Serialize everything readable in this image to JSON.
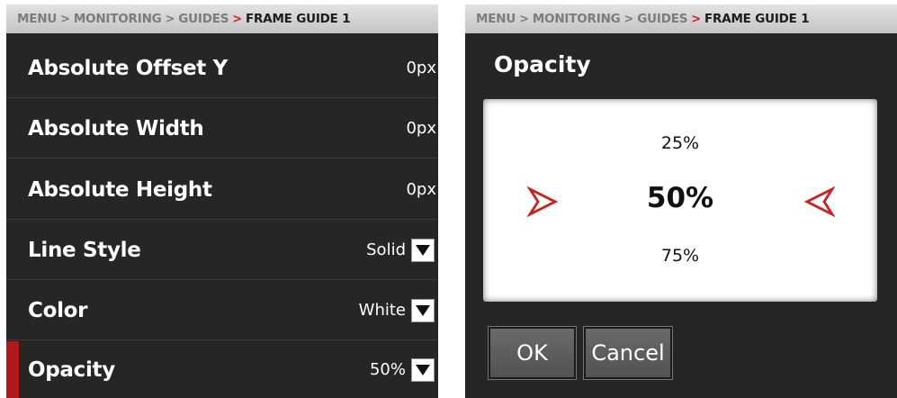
{
  "breadcrumb": {
    "items": [
      "MENU",
      "MONITORING",
      "GUIDES"
    ],
    "separator": ">",
    "current": "FRAME GUIDE 1"
  },
  "settings": {
    "rows": [
      {
        "label": "Absolute Offset Y",
        "value": "0px"
      },
      {
        "label": "Absolute Width",
        "value": "0px"
      },
      {
        "label": "Absolute Height",
        "value": "0px"
      },
      {
        "label": "Line Style",
        "value": "Solid"
      },
      {
        "label": "Color",
        "value": "White"
      },
      {
        "label": "Opacity",
        "value": "50%"
      }
    ]
  },
  "dialog": {
    "title": "Opacity",
    "options": {
      "prev": "25%",
      "selected": "50%",
      "next": "75%"
    },
    "ok_label": "OK",
    "cancel_label": "Cancel"
  },
  "icons": {
    "dropdown": "chevron-down-icon",
    "picker_left": "arrow-right-outline-icon",
    "picker_right": "arrow-left-outline-icon"
  },
  "colors": {
    "accent": "#cc1f1f",
    "selection_bar": "#b01a1a",
    "panel_bg": "#262626"
  }
}
